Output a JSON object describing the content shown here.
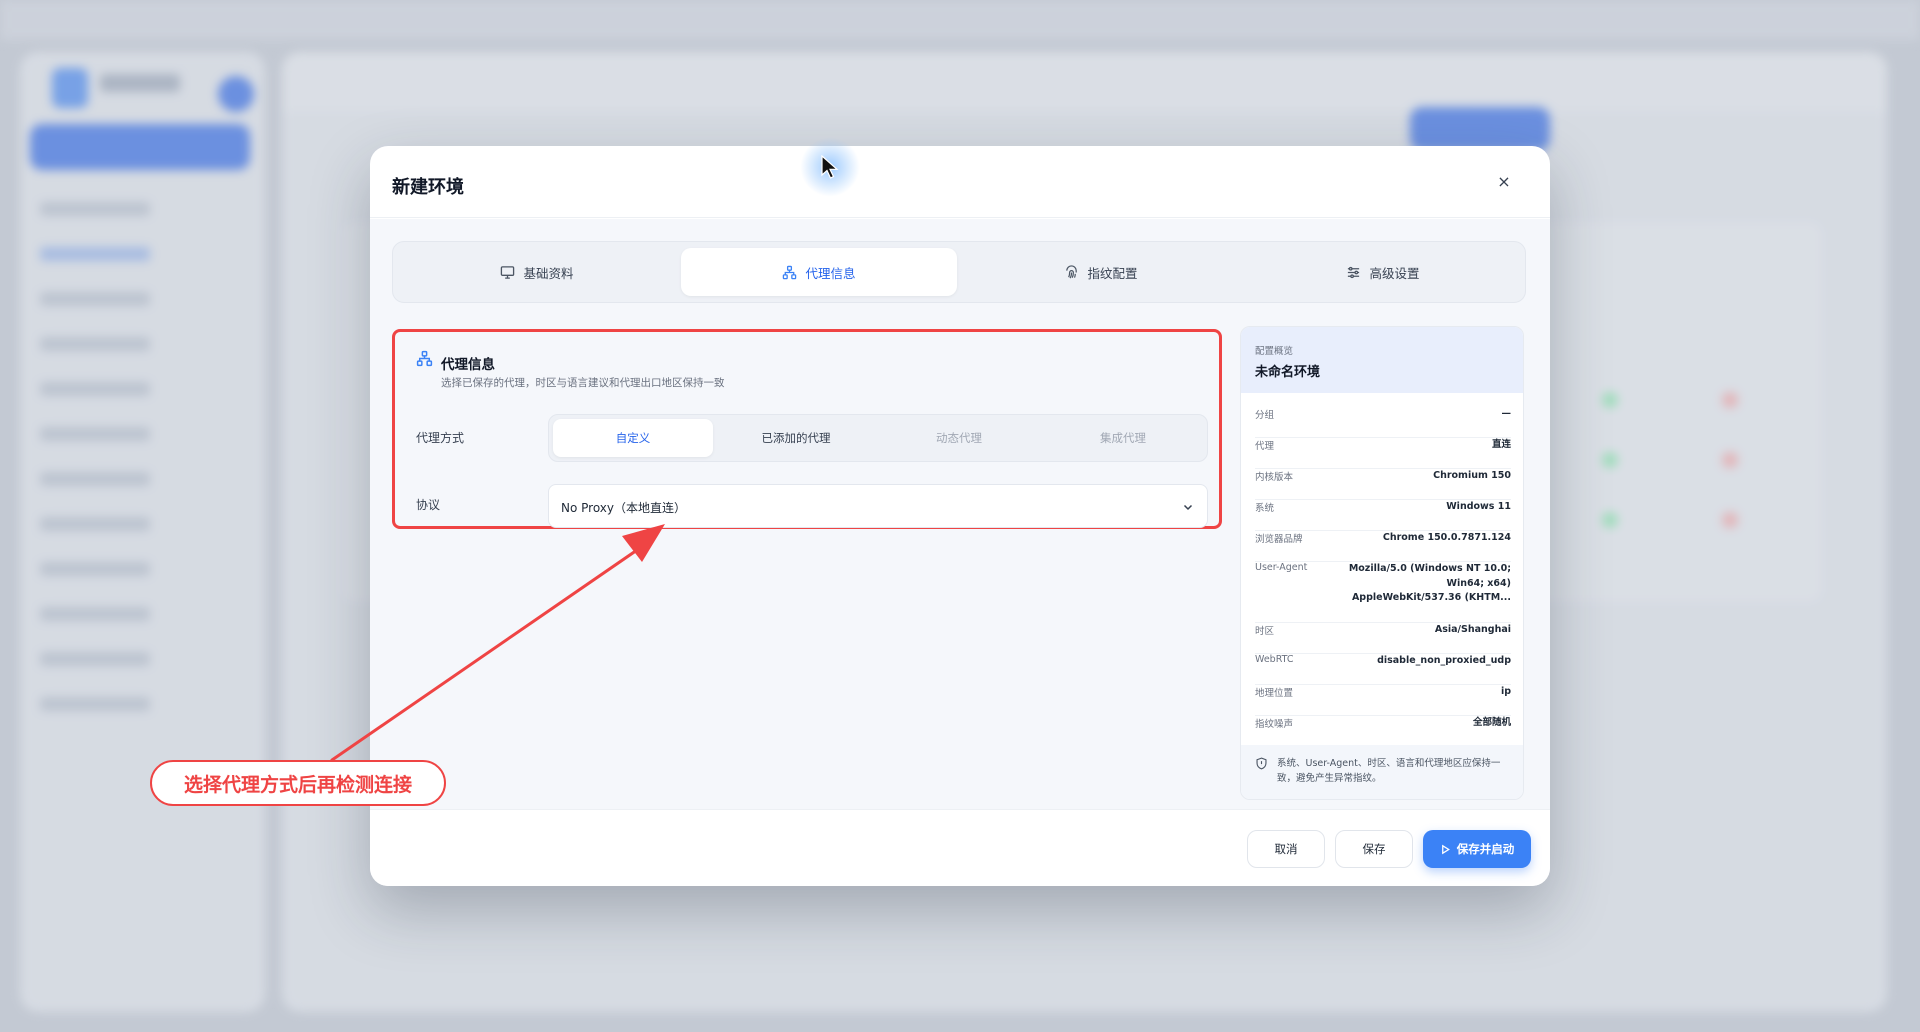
{
  "modal": {
    "title": "新建环境",
    "close_label": "×"
  },
  "tabs": [
    {
      "label": "基础资料",
      "icon": "monitor-icon"
    },
    {
      "label": "代理信息",
      "icon": "network-icon",
      "active": true
    },
    {
      "label": "指纹配置",
      "icon": "fingerprint-icon"
    },
    {
      "label": "高级设置",
      "icon": "sliders-icon"
    }
  ],
  "proxy_section": {
    "title": "代理信息",
    "subtitle": "选择已保存的代理，时区与语言建议和代理出口地区保持一致",
    "mode_label": "代理方式",
    "modes": [
      "自定义",
      "已添加的代理",
      "动态代理",
      "集成代理"
    ],
    "protocol_label": "协议",
    "protocol_value": "No Proxy（本地直连）"
  },
  "summary": {
    "caption": "配置概览",
    "title": "未命名环境",
    "rows": [
      {
        "key": "分组",
        "value": "—"
      },
      {
        "key": "代理",
        "value": "直连"
      },
      {
        "key": "内核版本",
        "value": "Chromium 150"
      },
      {
        "key": "系统",
        "value": "Windows 11"
      },
      {
        "key": "浏览器品牌",
        "value": "Chrome 150.0.7871.124"
      },
      {
        "key": "User-Agent",
        "value_lines": [
          "Mozilla/5.0 (Windows NT 10.0;",
          "Win64; x64)",
          "AppleWebKit/537.36 (KHTM..."
        ]
      },
      {
        "key": "时区",
        "value": "Asia/Shanghai"
      },
      {
        "key": "WebRTC",
        "value": "disable_non_proxied_udp"
      },
      {
        "key": "地理位置",
        "value": "ip"
      },
      {
        "key": "指纹噪声",
        "value": "全部随机"
      }
    ],
    "note": "系统、User-Agent、时区、语言和代理地区应保持一致，避免产生异常指纹。"
  },
  "footer": {
    "cancel_label": "取消",
    "save_label": "保存",
    "save_start_label": "保存并启动"
  },
  "annotation": {
    "callout": "选择代理方式后再检测连接",
    "color": "#ef4444"
  },
  "colors": {
    "accent": "#3b82f6",
    "annotation": "#ef4444"
  }
}
